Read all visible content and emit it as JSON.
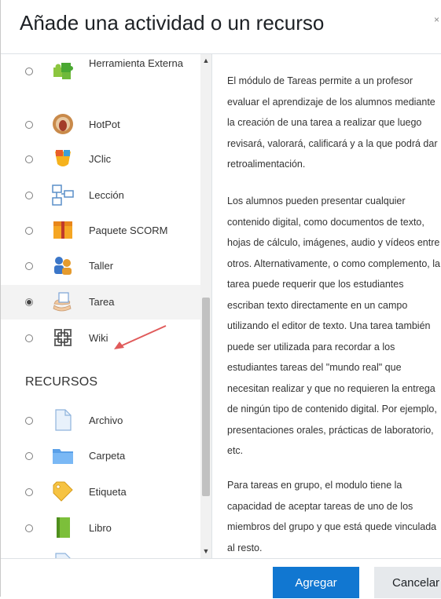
{
  "dialog": {
    "title": "Añade una actividad o un recurso",
    "close_label": "×"
  },
  "activities": [
    {
      "label": "Herramienta Externa",
      "icon": "puzzle-piece-icon",
      "selected": false
    },
    {
      "label": "HotPot",
      "icon": "hotpot-icon",
      "selected": false
    },
    {
      "label": "JClic",
      "icon": "jclic-icon",
      "selected": false
    },
    {
      "label": "Lección",
      "icon": "lesson-icon",
      "selected": false
    },
    {
      "label": "Paquete SCORM",
      "icon": "scorm-package-icon",
      "selected": false
    },
    {
      "label": "Taller",
      "icon": "workshop-icon",
      "selected": false
    },
    {
      "label": "Tarea",
      "icon": "assignment-hand-icon",
      "selected": true
    },
    {
      "label": "Wiki",
      "icon": "wiki-icon",
      "selected": false
    }
  ],
  "resources_heading": "RECURSOS",
  "resources": [
    {
      "label": "Archivo",
      "icon": "file-icon",
      "selected": false
    },
    {
      "label": "Carpeta",
      "icon": "folder-icon",
      "selected": false
    },
    {
      "label": "Etiqueta",
      "icon": "label-tag-icon",
      "selected": false
    },
    {
      "label": "Libro",
      "icon": "book-icon",
      "selected": false
    }
  ],
  "description": {
    "paragraphs": [
      "El módulo de Tareas permite a un profesor evaluar el aprendizaje de los alumnos mediante la creación de una tarea a realizar que luego revisará, valorará, calificará y a la que podrá dar retroalimentación.",
      "Los alumnos pueden presentar cualquier contenido digital, como documentos de texto, hojas de cálculo, imágenes, audio y vídeos entre otros. Alternativamente, o como complemento, la tarea puede requerir que los estudiantes escriban texto directamente en un campo utilizando el editor de texto. Una tarea también puede ser utilizada para recordar a los estudiantes tareas del \"mundo real\" que necesitan realizar y que no requieren la entrega de ningún tipo de contenido digital. Por ejemplo, presentaciones orales, prácticas de laboratorio, etc.",
      "Para tareas en grupo, el modulo tiene la capacidad de aceptar tareas de uno de los miembros del grupo y que está quede vinculada al resto."
    ]
  },
  "footer": {
    "add_label": "Agregar",
    "cancel_label": "Cancelar"
  },
  "colors": {
    "primary": "#1177d1",
    "selected_row": "#f3f3f3",
    "annotation_arrow": "#e05a5a"
  }
}
